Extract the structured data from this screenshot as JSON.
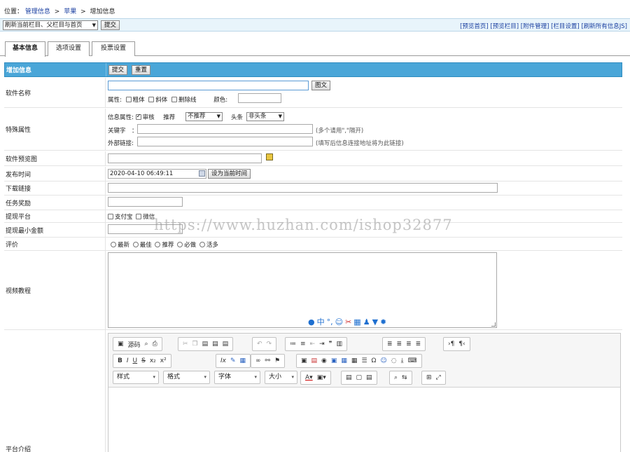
{
  "breadcrumb": {
    "prefix": "位置：",
    "items": [
      "管理信息",
      "苹果",
      "增加信息"
    ],
    "sep": ">"
  },
  "topbar": {
    "select_value": "刷新当前栏目、父栏目与首页",
    "submit_label": "提交",
    "links": [
      "[预览首页]",
      "[预览栏目]",
      "[附件管理]",
      "[栏目设置]",
      "[刷新所有信息JS]"
    ]
  },
  "tabs": [
    "基本信息",
    "选项设置",
    "投票设置"
  ],
  "form": {
    "header_label": "增加信息",
    "header_submit": "提交",
    "header_reset": "重置",
    "title_label": "软件名称",
    "title_button": "图文",
    "title_attrs_prefix": "属性:",
    "title_attrs": [
      "粗体",
      "斜体",
      "删除线"
    ],
    "color_label": "颜色:",
    "special_label": "特殊属性",
    "info_attr_prefix": "信息属性:",
    "check_label": "审核",
    "recommend_label": "推荐",
    "recommend_value": "不推荐",
    "headline_label": "头条",
    "headline_value": "非头条",
    "keyword_label": "关键字　：",
    "keyword_hint": "(多个请用\",\"隔开)",
    "link_label": "外部链接:",
    "link_hint": "(填写后信息连接地址将为此链接)",
    "preview_label": "软件预览图",
    "time_label": "发布时间",
    "time_value": "2020-04-10 06:49:11",
    "time_button": "设为当前时间",
    "download_label": "下载链接",
    "reward_label": "任务奖励",
    "withdraw_label": "提现平台",
    "withdraw_options": [
      "支付宝",
      "微信"
    ],
    "min_amount_label": "提现最小金额",
    "rating_label": "评价",
    "rating_options": [
      "最新",
      "最佳",
      "推荐",
      "必做",
      "活多"
    ],
    "video_label": "视频教程",
    "intro_label": "平台介绍"
  },
  "editor": {
    "source_label": "源码",
    "style_dd": "样式",
    "format_dd": "格式",
    "font_dd": "字体",
    "size_dd": "大小"
  },
  "watermark": "https://www.huzhan.com/ishop32877"
}
